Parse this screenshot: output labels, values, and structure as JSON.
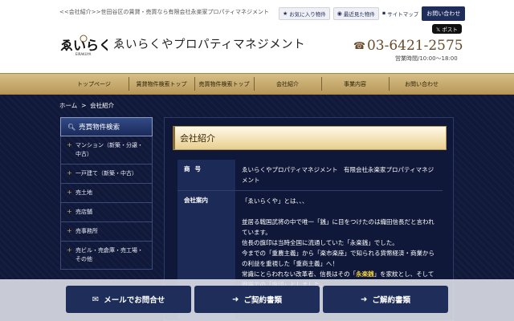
{
  "header": {
    "tagline": "<<会社紹介>>世田谷区の賃貸・売買なら有限会社永楽家プロパティマネジメント",
    "favorites_label": "お気に入り物件",
    "favorites_icon": "star-icon",
    "recent_label": "最近見た物件",
    "recent_icon": "eye-icon",
    "sitemap_label": "サイトマップ",
    "contact_label": "お問い合わせ",
    "x_post_label": "ポスト",
    "logo_text": "ゑいらくや",
    "company_name": "ゑいらくやプロパティマネジメント",
    "phone": "03-6421-2575",
    "hours": "営業時間/10:00～18:00"
  },
  "nav": {
    "items": [
      {
        "label": "トップページ"
      },
      {
        "label": "賃貸物件検索トップ"
      },
      {
        "label": "売買物件検索トップ"
      },
      {
        "label": "会社紹介"
      },
      {
        "label": "事業内容"
      },
      {
        "label": "お問い合わせ"
      }
    ]
  },
  "breadcrumb": {
    "home": "ホーム",
    "sep": ">",
    "current": "会社紹介"
  },
  "sidebar": {
    "title": "売買物件検索",
    "items": [
      {
        "label": "マンション（新築・分譲・中古）"
      },
      {
        "label": "一戸建て（新築・中古）"
      },
      {
        "label": "売土地"
      },
      {
        "label": "売店舗"
      },
      {
        "label": "売事務所"
      },
      {
        "label": "売ビル・売倉庫・売工場・その他"
      }
    ]
  },
  "content": {
    "heading": "会社紹介",
    "rows": [
      {
        "label": "商号",
        "value": "ゑいらくやプロパティマネジメント　有限会社永楽家プロパティマネジメント"
      },
      {
        "label": "会社案内"
      }
    ],
    "intro": {
      "p1": "「ゑいらくや」とは、、、",
      "p2": "並居る戦国武将の中で唯一「銭」に目をつけたのは織田信長だと言われています。",
      "p3": "信長の旗印は当時全国に流通していた「永楽銭」でした。",
      "p4": "今までの「重農主義」から「楽市楽座」で知られる貨幣経済・商業からの利益を重視した「重商主義」へ！",
      "p5_before": "常識にとらわれない改革者、信長はその「",
      "p5_highlight": "永楽銭",
      "p5_after": "」を家紋とし、そして戦場での「旗印」としました。"
    }
  },
  "bottom": {
    "mail_label": "メールでお問合せ",
    "contract_label": "ご契約書類",
    "cancel_label": "ご解約書類"
  }
}
